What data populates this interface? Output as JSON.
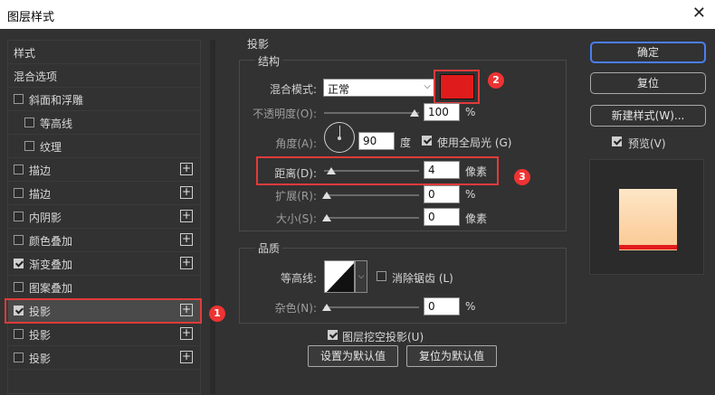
{
  "window": {
    "title": "图层样式",
    "close_glyph": "✕"
  },
  "left_panel": {
    "items": [
      {
        "label": "样式",
        "checkbox": false,
        "checked": false,
        "plus": false,
        "indent": 0
      },
      {
        "label": "混合选项",
        "checkbox": false,
        "checked": false,
        "plus": false,
        "indent": 0
      },
      {
        "label": "斜面和浮雕",
        "checkbox": true,
        "checked": false,
        "plus": false,
        "indent": 0
      },
      {
        "label": "等高线",
        "checkbox": true,
        "checked": false,
        "plus": false,
        "indent": 1
      },
      {
        "label": "纹理",
        "checkbox": true,
        "checked": false,
        "plus": false,
        "indent": 1
      },
      {
        "label": "描边",
        "checkbox": true,
        "checked": false,
        "plus": true,
        "indent": 0
      },
      {
        "label": "描边",
        "checkbox": true,
        "checked": false,
        "plus": true,
        "indent": 0
      },
      {
        "label": "内阴影",
        "checkbox": true,
        "checked": false,
        "plus": true,
        "indent": 0
      },
      {
        "label": "颜色叠加",
        "checkbox": true,
        "checked": false,
        "plus": true,
        "indent": 0
      },
      {
        "label": "渐变叠加",
        "checkbox": true,
        "checked": true,
        "plus": true,
        "indent": 0
      },
      {
        "label": "图案叠加",
        "checkbox": true,
        "checked": false,
        "plus": false,
        "indent": 0
      },
      {
        "label": "投影",
        "checkbox": true,
        "checked": true,
        "plus": true,
        "indent": 0,
        "selected": true
      },
      {
        "label": "投影",
        "checkbox": true,
        "checked": false,
        "plus": true,
        "indent": 0
      },
      {
        "label": "投影",
        "checkbox": true,
        "checked": false,
        "plus": true,
        "indent": 0
      }
    ]
  },
  "shadow": {
    "section_title": "投影",
    "structure": {
      "title": "结构",
      "blend_mode_label": "混合模式:",
      "blend_mode_value": "正常",
      "color": "#e01b1b",
      "opacity_label": "不透明度(O):",
      "opacity_value": "100",
      "opacity_unit": "%",
      "opacity_fraction": 1.0,
      "angle_label": "角度(A):",
      "angle_value": "90",
      "angle_unit": "度",
      "global_light_label": "使用全局光 (G)",
      "global_light_checked": true,
      "distance_label": "距离(D):",
      "distance_value": "4",
      "distance_unit": "像素",
      "spread_label": "扩展(R):",
      "spread_value": "0",
      "spread_unit": "%",
      "size_label": "大小(S):",
      "size_value": "0",
      "size_unit": "像素"
    },
    "quality": {
      "title": "品质",
      "contour_label": "等高线:",
      "anti_alias_label": "消除锯齿 (L)",
      "anti_alias_checked": false,
      "noise_label": "杂色(N):",
      "noise_value": "0",
      "noise_unit": "%"
    },
    "knockout_label": "图层挖空投影(U)",
    "knockout_checked": true,
    "set_default_label": "设置为默认值",
    "reset_default_label": "复位为默认值"
  },
  "right_panel": {
    "ok_label": "确定",
    "reset_label": "复位",
    "new_style_label": "新建样式(W)...",
    "preview_label": "预览(V)",
    "preview_checked": true
  },
  "annotations": {
    "accent_color": "#e23a3a",
    "badge_1": "1",
    "badge_2": "2",
    "badge_3": "3"
  }
}
